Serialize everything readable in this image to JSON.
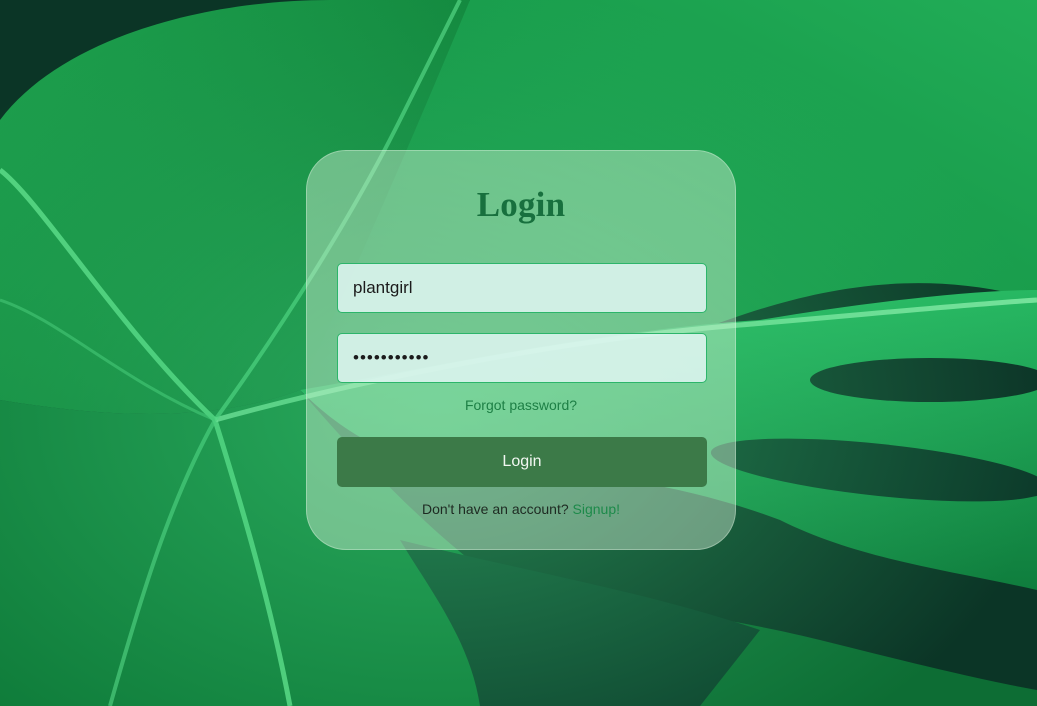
{
  "login": {
    "title": "Login",
    "username_value": "plantgirl",
    "password_value": "•••••••••••",
    "forgot_password": "Forgot password?",
    "login_button": "Login",
    "signup_prompt": "Don't have an account?",
    "signup_link": "Signup!"
  },
  "colors": {
    "accent": "#18703e",
    "button": "#3c7a48",
    "field_border": "#2cb56a",
    "link": "#1d7f45"
  }
}
